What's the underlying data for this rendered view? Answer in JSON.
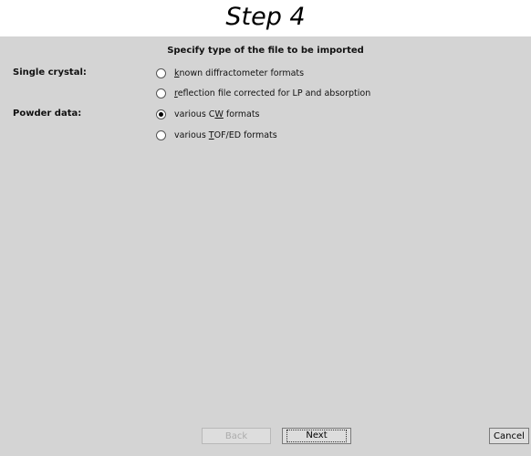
{
  "step_title": "Step 4",
  "heading": "Specify type of the file to be imported",
  "groups": {
    "single_crystal": "Single crystal:",
    "powder": "Powder data:"
  },
  "options": [
    {
      "pre": "",
      "ul": "k",
      "post": "nown diffractometer formats",
      "checked": false
    },
    {
      "pre": "",
      "ul": "r",
      "post": "eflection file corrected for LP and absorption",
      "checked": false
    },
    {
      "pre": "various C",
      "ul": "W",
      "post": " formats",
      "checked": true
    },
    {
      "pre": "various ",
      "ul": "T",
      "post": "OF/ED formats",
      "checked": false
    }
  ],
  "buttons": {
    "back": "Back",
    "next": "Next",
    "cancel": "Cancel"
  }
}
